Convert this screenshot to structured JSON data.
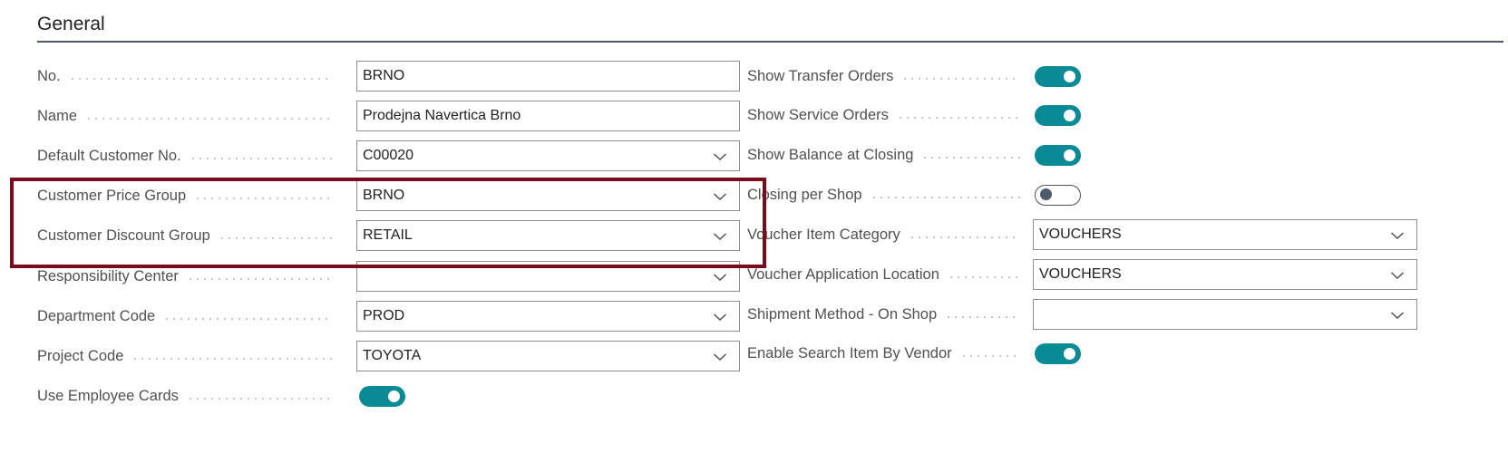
{
  "section": {
    "title": "General"
  },
  "left_fields": [
    {
      "label": "No.",
      "value": "BRNO",
      "type": "text"
    },
    {
      "label": "Name",
      "value": "Prodejna Navertica Brno",
      "type": "text"
    },
    {
      "label": "Default Customer No.",
      "value": "C00020",
      "type": "dropdown"
    },
    {
      "label": "Customer Price Group",
      "value": "BRNO",
      "type": "dropdown"
    },
    {
      "label": "Customer Discount Group",
      "value": "RETAIL",
      "type": "dropdown"
    },
    {
      "label": "Responsibility Center",
      "value": "",
      "type": "dropdown"
    },
    {
      "label": "Department Code",
      "value": "PROD",
      "type": "dropdown"
    },
    {
      "label": "Project Code",
      "value": "TOYOTA",
      "type": "dropdown"
    },
    {
      "label": "Use Employee Cards",
      "value": true,
      "type": "toggle"
    }
  ],
  "right_fields": [
    {
      "label": "Show Transfer Orders",
      "value": true,
      "type": "toggle"
    },
    {
      "label": "Show Service Orders",
      "value": true,
      "type": "toggle"
    },
    {
      "label": "Show Balance at Closing",
      "value": true,
      "type": "toggle"
    },
    {
      "label": "Closing per Shop",
      "value": false,
      "type": "toggle"
    },
    {
      "label": "Voucher Item Category",
      "value": "VOUCHERS",
      "type": "dropdown"
    },
    {
      "label": "Voucher Application Location",
      "value": "VOUCHERS",
      "type": "dropdown"
    },
    {
      "label": "Shipment Method - On Shop",
      "value": "",
      "type": "dropdown"
    },
    {
      "label": "Enable Search Item By Vendor",
      "value": true,
      "type": "toggle"
    }
  ],
  "colors": {
    "accent": "#0a8a94",
    "highlight": "#7a0b1c",
    "label": "#505050",
    "value": "#212121"
  },
  "icons": {
    "dropdown": "chevron-down-icon"
  }
}
